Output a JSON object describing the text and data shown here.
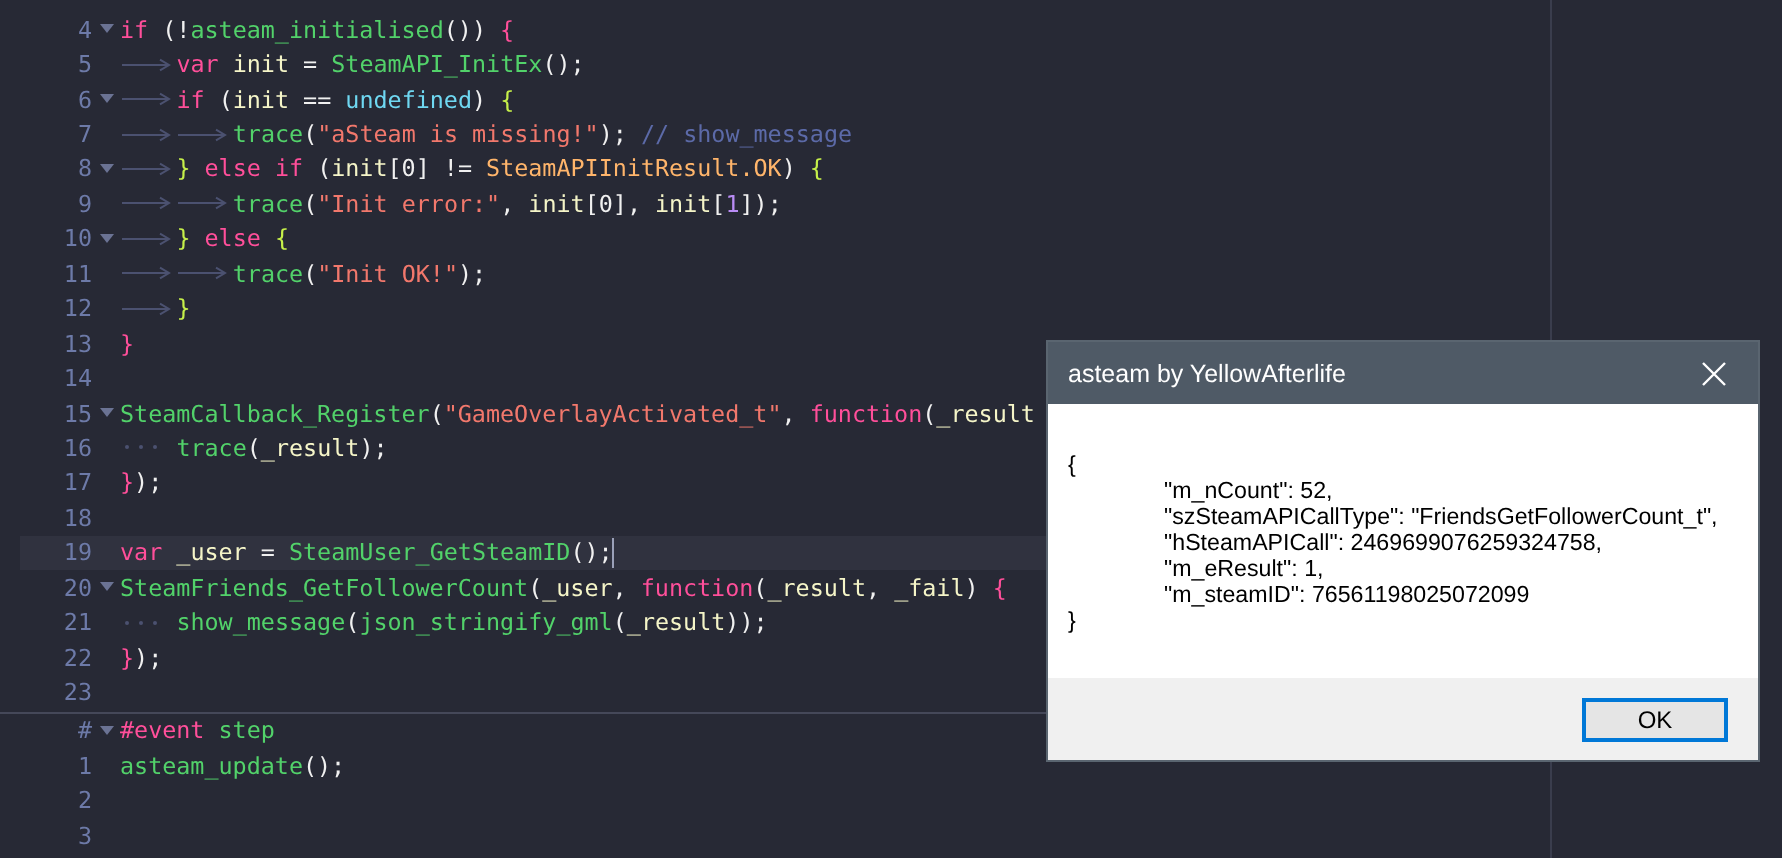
{
  "editor": {
    "sections": [
      {
        "lines": [
          {
            "number": "4",
            "foldable": true,
            "current": false,
            "tokens": [
              {
                "kind": "keyword",
                "text": "if "
              },
              {
                "kind": "plain",
                "text": "(!"
              },
              {
                "kind": "func",
                "text": "asteam_initialised"
              },
              {
                "kind": "plain",
                "text": "()) "
              },
              {
                "kind": "bracea",
                "text": "{"
              }
            ]
          },
          {
            "number": "5",
            "foldable": false,
            "current": false,
            "indent": [
              {
                "kind": "tab"
              }
            ],
            "tokens": [
              {
                "kind": "keyword",
                "text": "var "
              },
              {
                "kind": "ident",
                "text": "init"
              },
              {
                "kind": "plain",
                "text": " = "
              },
              {
                "kind": "func",
                "text": "SteamAPI_InitEx"
              },
              {
                "kind": "plain",
                "text": "();"
              }
            ]
          },
          {
            "number": "6",
            "foldable": true,
            "current": false,
            "indent": [
              {
                "kind": "tab"
              }
            ],
            "tokens": [
              {
                "kind": "keyword",
                "text": "if "
              },
              {
                "kind": "plain",
                "text": "("
              },
              {
                "kind": "ident",
                "text": "init"
              },
              {
                "kind": "plain",
                "text": " == "
              },
              {
                "kind": "const",
                "text": "undefined"
              },
              {
                "kind": "plain",
                "text": ") "
              },
              {
                "kind": "braceb",
                "text": "{"
              }
            ]
          },
          {
            "number": "7",
            "foldable": false,
            "current": false,
            "indent": [
              {
                "kind": "tab"
              },
              {
                "kind": "tab"
              }
            ],
            "tokens": [
              {
                "kind": "func",
                "text": "trace"
              },
              {
                "kind": "plain",
                "text": "("
              },
              {
                "kind": "string",
                "text": "\"aSteam is missing!\""
              },
              {
                "kind": "plain",
                "text": "); "
              },
              {
                "kind": "comment",
                "text": "// show_message"
              }
            ]
          },
          {
            "number": "8",
            "foldable": true,
            "current": false,
            "indent": [
              {
                "kind": "tab"
              }
            ],
            "tokens": [
              {
                "kind": "braceb",
                "text": "} "
              },
              {
                "kind": "keyword",
                "text": "else if "
              },
              {
                "kind": "plain",
                "text": "("
              },
              {
                "kind": "ident",
                "text": "init"
              },
              {
                "kind": "plain",
                "text": "[0] != "
              },
              {
                "kind": "enum",
                "text": "SteamAPIInitResult.OK"
              },
              {
                "kind": "plain",
                "text": ") "
              },
              {
                "kind": "braceb",
                "text": "{"
              }
            ]
          },
          {
            "number": "9",
            "foldable": false,
            "current": false,
            "indent": [
              {
                "kind": "tab"
              },
              {
                "kind": "tab"
              }
            ],
            "tokens": [
              {
                "kind": "func",
                "text": "trace"
              },
              {
                "kind": "plain",
                "text": "("
              },
              {
                "kind": "string",
                "text": "\"Init error:\""
              },
              {
                "kind": "plain",
                "text": ", "
              },
              {
                "kind": "ident",
                "text": "init"
              },
              {
                "kind": "plain",
                "text": "[0], "
              },
              {
                "kind": "ident",
                "text": "init"
              },
              {
                "kind": "plain",
                "text": "["
              },
              {
                "kind": "number",
                "text": "1"
              },
              {
                "kind": "plain",
                "text": "]);"
              }
            ]
          },
          {
            "number": "10",
            "foldable": true,
            "current": false,
            "indent": [
              {
                "kind": "tab"
              }
            ],
            "tokens": [
              {
                "kind": "braceb",
                "text": "} "
              },
              {
                "kind": "keyword",
                "text": "else "
              },
              {
                "kind": "braceb",
                "text": "{"
              }
            ]
          },
          {
            "number": "11",
            "foldable": false,
            "current": false,
            "indent": [
              {
                "kind": "tab"
              },
              {
                "kind": "tab"
              }
            ],
            "tokens": [
              {
                "kind": "func",
                "text": "trace"
              },
              {
                "kind": "plain",
                "text": "("
              },
              {
                "kind": "string",
                "text": "\"Init OK!\""
              },
              {
                "kind": "plain",
                "text": ");"
              }
            ]
          },
          {
            "number": "12",
            "foldable": false,
            "current": false,
            "indent": [
              {
                "kind": "tab"
              }
            ],
            "tokens": [
              {
                "kind": "braceb",
                "text": "}"
              }
            ]
          },
          {
            "number": "13",
            "foldable": false,
            "current": false,
            "tokens": [
              {
                "kind": "bracea",
                "text": "}"
              }
            ]
          },
          {
            "number": "14",
            "foldable": false,
            "current": false
          },
          {
            "number": "15",
            "foldable": true,
            "current": false,
            "tokens": [
              {
                "kind": "func",
                "text": "SteamCallback_Register"
              },
              {
                "kind": "plain",
                "text": "("
              },
              {
                "kind": "string",
                "text": "\"GameOverlayActivated_t\""
              },
              {
                "kind": "plain",
                "text": ", "
              },
              {
                "kind": "keyword",
                "text": "function"
              },
              {
                "kind": "plain",
                "text": "("
              },
              {
                "kind": "ident",
                "text": "_result"
              }
            ]
          },
          {
            "number": "16",
            "foldable": false,
            "current": false,
            "indent": [
              {
                "kind": "spaces"
              }
            ],
            "tokens": [
              {
                "kind": "func",
                "text": "trace"
              },
              {
                "kind": "plain",
                "text": "("
              },
              {
                "kind": "ident",
                "text": "_result"
              },
              {
                "kind": "plain",
                "text": ");"
              }
            ]
          },
          {
            "number": "17",
            "foldable": false,
            "current": false,
            "tokens": [
              {
                "kind": "bracea",
                "text": "}"
              },
              {
                "kind": "plain",
                "text": ");"
              }
            ]
          },
          {
            "number": "18",
            "foldable": false,
            "current": false
          },
          {
            "number": "19",
            "foldable": false,
            "current": true,
            "tokens": [
              {
                "kind": "keyword",
                "text": "var "
              },
              {
                "kind": "ident",
                "text": "_user"
              },
              {
                "kind": "plain",
                "text": " = "
              },
              {
                "kind": "func",
                "text": "SteamUser_GetSteamID"
              },
              {
                "kind": "plain",
                "text": "();"
              }
            ]
          },
          {
            "number": "20",
            "foldable": true,
            "current": false,
            "tokens": [
              {
                "kind": "func",
                "text": "SteamFriends_GetFollowerCount"
              },
              {
                "kind": "plain",
                "text": "("
              },
              {
                "kind": "ident",
                "text": "_user"
              },
              {
                "kind": "plain",
                "text": ", "
              },
              {
                "kind": "keyword",
                "text": "function"
              },
              {
                "kind": "plain",
                "text": "("
              },
              {
                "kind": "ident",
                "text": "_result"
              },
              {
                "kind": "plain",
                "text": ", "
              },
              {
                "kind": "ident",
                "text": "_fail"
              },
              {
                "kind": "plain",
                "text": ") "
              },
              {
                "kind": "bracea",
                "text": "{"
              }
            ]
          },
          {
            "number": "21",
            "foldable": false,
            "current": false,
            "indent": [
              {
                "kind": "spaces"
              }
            ],
            "tokens": [
              {
                "kind": "func",
                "text": "show_message"
              },
              {
                "kind": "plain",
                "text": "("
              },
              {
                "kind": "func",
                "text": "json_stringify_gml"
              },
              {
                "kind": "plain",
                "text": "("
              },
              {
                "kind": "ident",
                "text": "_result"
              },
              {
                "kind": "plain",
                "text": "));"
              }
            ]
          },
          {
            "number": "22",
            "foldable": false,
            "current": false,
            "tokens": [
              {
                "kind": "bracea",
                "text": "}"
              },
              {
                "kind": "plain",
                "text": ");"
              }
            ]
          },
          {
            "number": "23",
            "foldable": false,
            "current": false
          }
        ]
      },
      {
        "lines": [
          {
            "number": "#",
            "foldable": true,
            "current": false,
            "tokens": [
              {
                "kind": "keyword",
                "text": "#event "
              },
              {
                "kind": "func",
                "text": "step"
              }
            ]
          },
          {
            "number": "1",
            "foldable": false,
            "current": false,
            "tokens": [
              {
                "kind": "func",
                "text": "asteam_update"
              },
              {
                "kind": "plain",
                "text": "();"
              }
            ]
          },
          {
            "number": "2",
            "foldable": false,
            "current": false
          },
          {
            "number": "3",
            "foldable": false,
            "current": false
          }
        ]
      }
    ]
  },
  "dialog": {
    "title": "asteam by YellowAfterlife",
    "message": [
      {
        "text": "{",
        "indent": false
      },
      {
        "text": "\"m_nCount\": 52,",
        "indent": true
      },
      {
        "text": "\"szSteamAPICallType\": \"FriendsGetFollowerCount_t\",",
        "indent": true
      },
      {
        "text": "\"hSteamAPICall\": 2469699076259324758,",
        "indent": true
      },
      {
        "text": "\"m_eResult\": 1,",
        "indent": true
      },
      {
        "text": "\"m_steamID\": 76561198025072099",
        "indent": true
      },
      {
        "text": "}",
        "indent": false
      }
    ],
    "button": {
      "label": "OK",
      "focused": true
    }
  }
}
